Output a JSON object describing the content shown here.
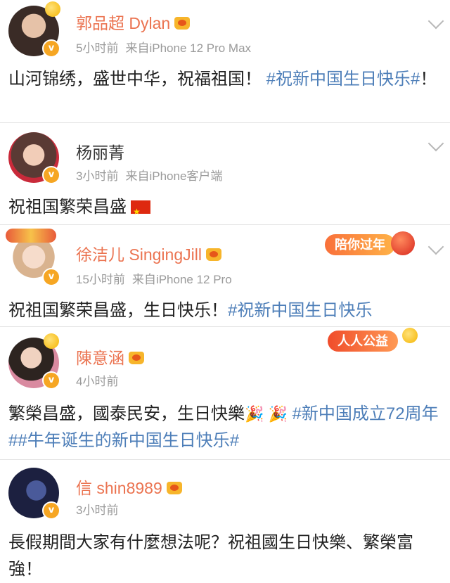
{
  "posts": [
    {
      "name": "郭品超 Dylan",
      "time": "5小时前",
      "source": "来自iPhone 12 Pro Max",
      "text": "山河锦绣，盛世中华，祝福祖国！",
      "hashtag": "#祝新中国生日快乐#",
      "trailing": "！"
    },
    {
      "name": "杨丽菁",
      "time": "3小时前",
      "source": "来自iPhone客户端",
      "text": "祝祖国繁荣昌盛"
    },
    {
      "name": "徐洁儿 SingingJill",
      "time": "15小时前",
      "source": "来自iPhone 12 Pro",
      "text": "祝祖国繁荣昌盛，生日快乐！",
      "hashtag": "#祝新中国生日快乐",
      "banner": "陪你过年"
    },
    {
      "name": "陳意涵",
      "time": "4小时前",
      "text": "繁榮昌盛，國泰民安，生日快樂",
      "emoji": "🎉 🎉",
      "hashtag": "#新中国成立72周年##牛年诞生的新中国生日快乐#",
      "banner": "人人公益"
    },
    {
      "name": "信 shin8989",
      "time": "3小时前",
      "text": "長假期間大家有什麼想法呢？祝祖國生日快樂、繁榮富強！"
    }
  ],
  "icons": {
    "verified": "verified-badge-icon",
    "crown": "crown-membership-icon",
    "more": "chevron-down-icon",
    "flag": "china-flag-icon"
  },
  "colors": {
    "name_highlight": "#eb7350",
    "hashtag": "#4d7eb8",
    "meta": "#9a9a9a",
    "verified": "#f6a623"
  }
}
